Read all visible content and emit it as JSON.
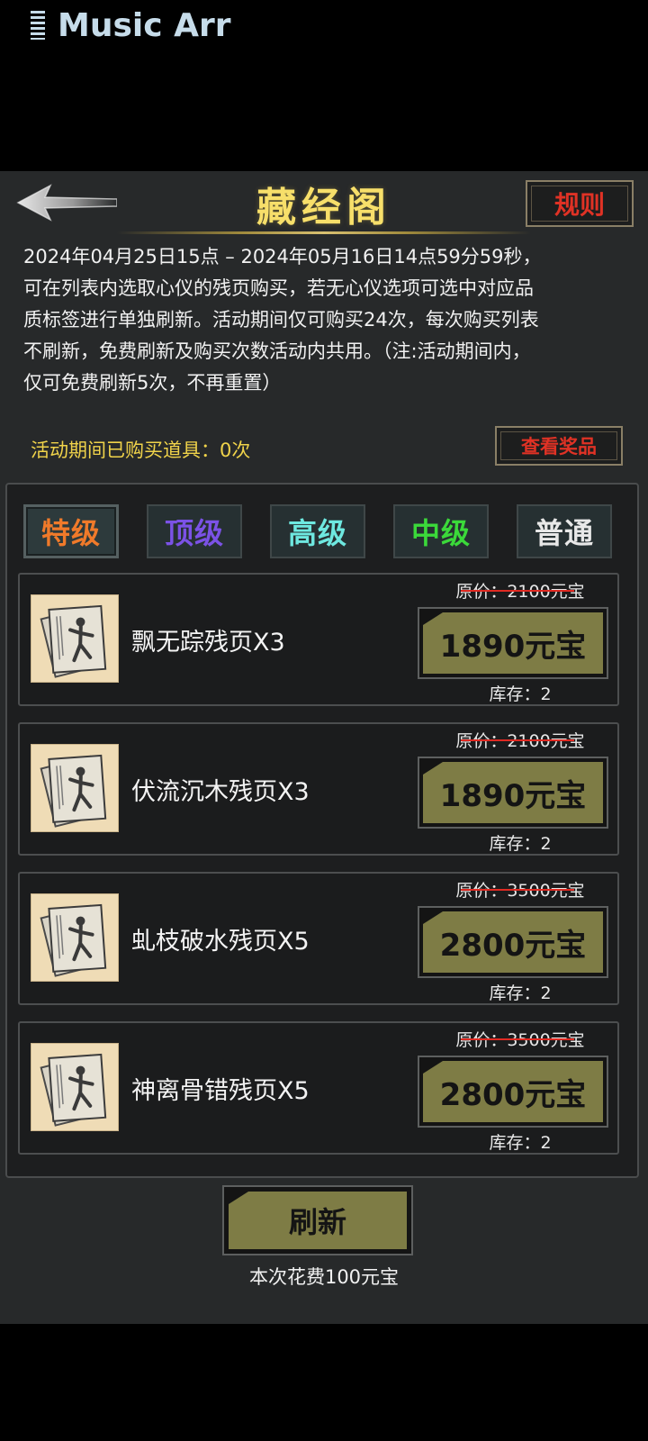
{
  "status_bar": {
    "app_name": "Music Arr"
  },
  "header": {
    "title": "藏经阁",
    "rules_label": "规则"
  },
  "description": [
    "2024年04月25日15点 – 2024年05月16日14点59分59秒，",
    "可在列表内选取心仪的残页购买，若无心仪选项可选中对应品",
    "质标签进行单独刷新。活动期间仅可购买24次，每次购买列表",
    "不刷新，免费刷新及购买次数活动内共用。（注:活动期间内，",
    "仅可免费刷新5次，不再重置）"
  ],
  "purchase_info": {
    "text": "活动期间已购买道具：0次",
    "prizes_label": "查看奖品"
  },
  "tabs": [
    {
      "label": "特级",
      "color": "#f07a2a",
      "active": true
    },
    {
      "label": "顶级",
      "color": "#7b52e6",
      "active": false
    },
    {
      "label": "高级",
      "color": "#6ee8e0",
      "active": false
    },
    {
      "label": "中级",
      "color": "#3bd93a",
      "active": false
    },
    {
      "label": "普通",
      "color": "#e8e8e8",
      "active": false
    }
  ],
  "items": [
    {
      "name": "飘无踪残页X3",
      "original_price": "原价：2100元宝",
      "price": "1890元宝",
      "stock": "库存：2"
    },
    {
      "name": "伏流沉木残页X3",
      "original_price": "原价：2100元宝",
      "price": "1890元宝",
      "stock": "库存：2"
    },
    {
      "name": "虬枝破水残页X5",
      "original_price": "原价：3500元宝",
      "price": "2800元宝",
      "stock": "库存：2"
    },
    {
      "name": "神离骨错残页X5",
      "original_price": "原价：3500元宝",
      "price": "2800元宝",
      "stock": "库存：2"
    }
  ],
  "refresh": {
    "label": "刷新",
    "cost_text": "本次花费100元宝"
  }
}
